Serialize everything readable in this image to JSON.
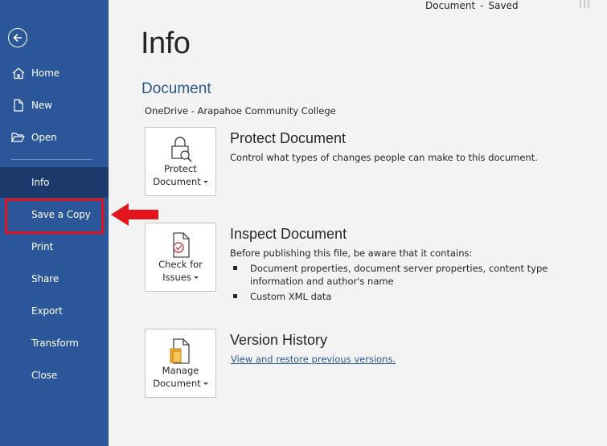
{
  "titlebar": {
    "doc_name": "Document",
    "separator": "-",
    "status": "Saved"
  },
  "sidebar": {
    "items": [
      {
        "label": "Home"
      },
      {
        "label": "New"
      },
      {
        "label": "Open"
      },
      {
        "label": "Info"
      },
      {
        "label": "Save a Copy"
      },
      {
        "label": "Print"
      },
      {
        "label": "Share"
      },
      {
        "label": "Export"
      },
      {
        "label": "Transform"
      },
      {
        "label": "Close"
      }
    ],
    "active": "Info"
  },
  "main": {
    "title": "Info",
    "document_heading": "Document",
    "location": "OneDrive - Arapahoe Community College",
    "protect": {
      "tile_line1": "Protect",
      "tile_line2": "Document",
      "title": "Protect Document",
      "description": "Control what types of changes people can make to this document."
    },
    "inspect": {
      "tile_line1": "Check for",
      "tile_line2": "Issues",
      "title": "Inspect Document",
      "description": "Before publishing this file, be aware that it contains:",
      "bullets": [
        "Document properties, document server properties, content type information and author's name",
        "Custom XML data"
      ]
    },
    "version": {
      "tile_line1": "Manage",
      "tile_line2": "Document",
      "title": "Version History",
      "link": "View and restore previous versions."
    }
  },
  "colors": {
    "sidebar": "#2b579a",
    "active_item": "#1b3a6b",
    "highlight": "#e3141b",
    "link": "#2b579a"
  }
}
